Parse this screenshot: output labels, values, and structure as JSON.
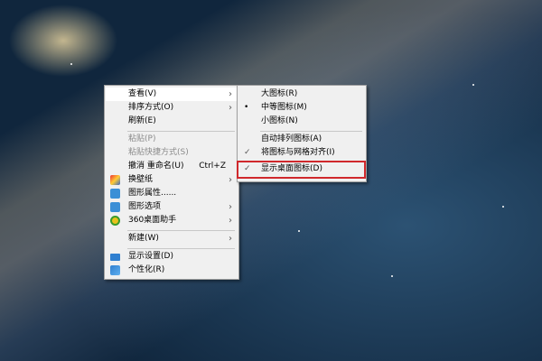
{
  "main_menu": [
    {
      "label": "查看(V)",
      "submenu": true
    },
    {
      "label": "排序方式(O)",
      "submenu": true
    },
    {
      "label": "刷新(E)"
    },
    {
      "label": "粘贴(P)",
      "disabled": true
    },
    {
      "label": "粘贴快捷方式(S)",
      "disabled": true
    },
    {
      "label": "撤消 重命名(U)",
      "shortcut": "Ctrl+Z"
    },
    {
      "label": "换壁纸",
      "submenu": true,
      "icon": "wallpaper-icon"
    },
    {
      "label": "图形属性......",
      "icon": "graphics-properties-icon"
    },
    {
      "label": "图形选项",
      "submenu": true,
      "icon": "graphics-options-icon"
    },
    {
      "label": "360桌面助手",
      "submenu": true,
      "icon": "360-icon"
    },
    {
      "label": "新建(W)",
      "submenu": true
    },
    {
      "label": "显示设置(D)",
      "icon": "display-icon"
    },
    {
      "label": "个性化(R)",
      "icon": "personalize-icon"
    }
  ],
  "view_submenu": [
    {
      "label": "大图标(R)"
    },
    {
      "label": "中等图标(M)",
      "bullet": "•"
    },
    {
      "label": "小图标(N)"
    },
    {
      "label": "自动排列图标(A)"
    },
    {
      "label": "将图标与网格对齐(I)",
      "check": "✓"
    },
    {
      "label": "显示桌面图标(D)",
      "check": "✓",
      "highlighted": true
    }
  ],
  "colors": {
    "highlight_box": "#d0282c"
  }
}
